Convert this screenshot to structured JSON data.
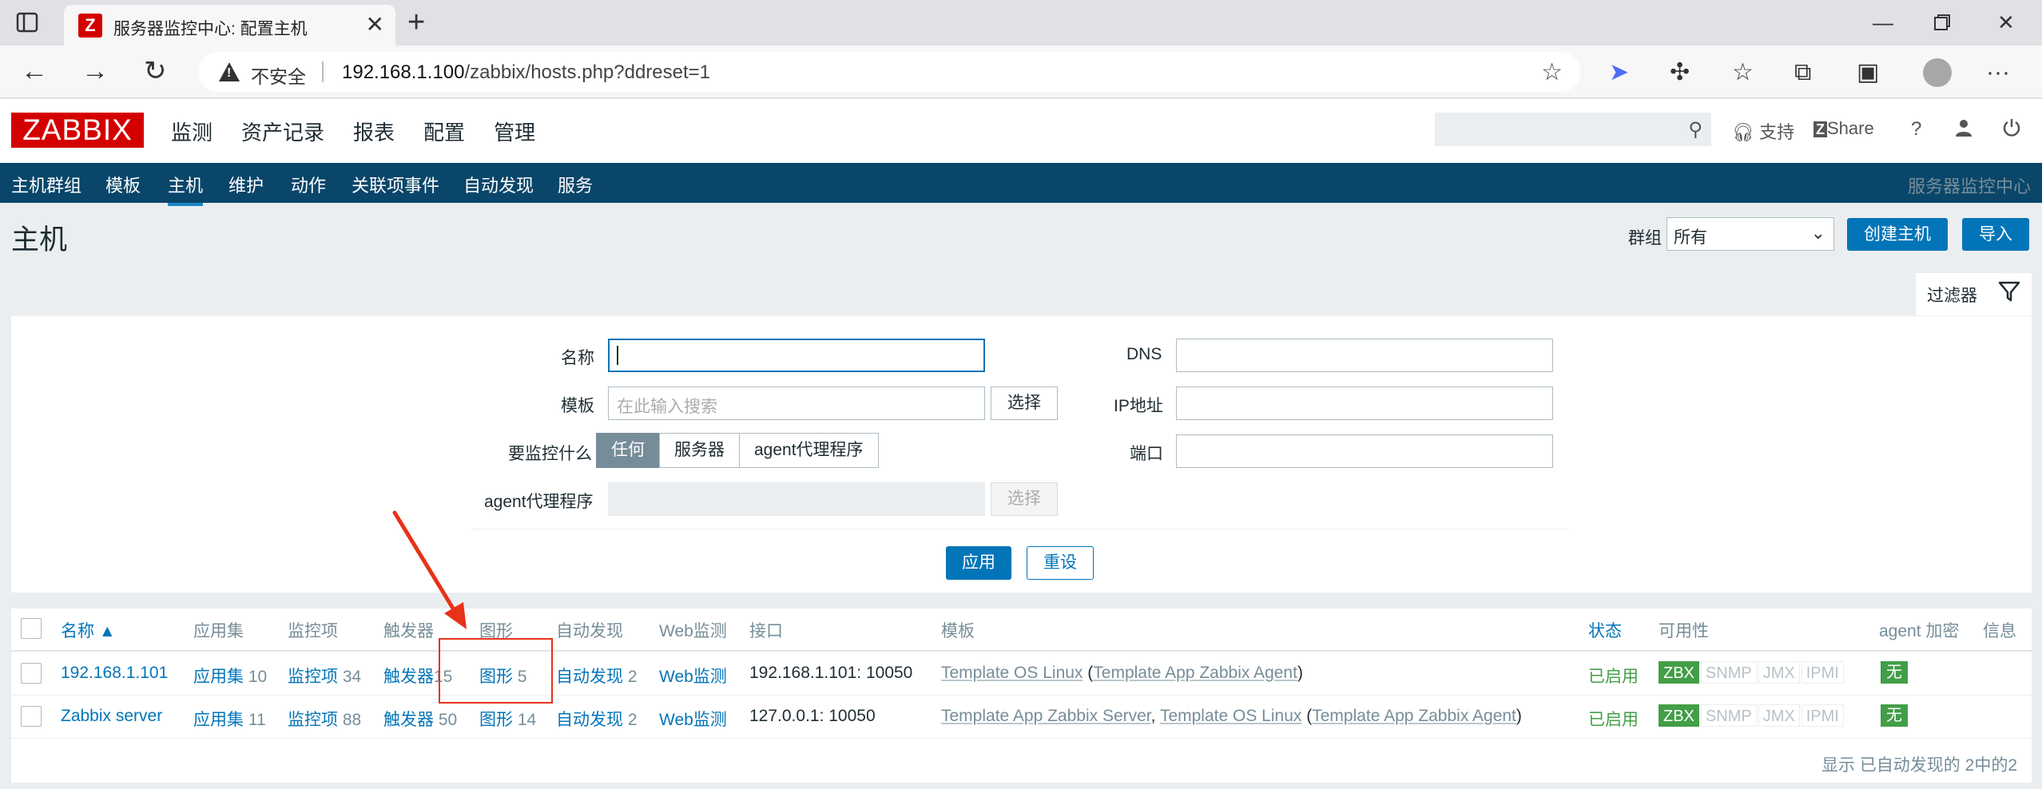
{
  "browser": {
    "tab_title": "服务器监控中心: 配置主机",
    "favicon_letter": "Z",
    "insecure_label": "不安全",
    "url_host": "192.168.1.100",
    "url_path": "/zabbix/hosts.php?ddreset=1"
  },
  "header": {
    "logo": "ZABBIX",
    "menu": [
      "监测",
      "资产记录",
      "报表",
      "配置",
      "管理"
    ],
    "active_menu": "配置",
    "support": "支持",
    "share": "Share",
    "help": "?"
  },
  "subnav": {
    "items": [
      "主机群组",
      "模板",
      "主机",
      "维护",
      "动作",
      "关联项事件",
      "自动发现",
      "服务"
    ],
    "active": "主机",
    "server_name": "服务器监控中心"
  },
  "page": {
    "title": "主机",
    "group_label": "群组",
    "group_value": "所有",
    "create_button": "创建主机",
    "import_button": "导入"
  },
  "filter": {
    "tab_label": "过滤器",
    "name_label": "名称",
    "name_value": "",
    "template_label": "模板",
    "template_placeholder": "在此输入搜索",
    "select_button": "选择",
    "monitor_label": "要监控什么",
    "monitor_options": [
      "任何",
      "服务器",
      "agent代理程序"
    ],
    "monitor_selected": "任何",
    "proxy_label": "agent代理程序",
    "proxy_select_button": "选择",
    "dns_label": "DNS",
    "ip_label": "IP地址",
    "port_label": "端口",
    "apply_button": "应用",
    "reset_button": "重设"
  },
  "table": {
    "headers": {
      "name": "名称 ▲",
      "apps": "应用集",
      "items": "监控项",
      "triggers": "触发器",
      "graphs": "图形",
      "discovery": "自动发现",
      "web": "Web监测",
      "interface": "接口",
      "templates": "模板",
      "status": "状态",
      "availability": "可用性",
      "encryption": "agent 加密",
      "info": "信息"
    },
    "rows": [
      {
        "name": "192.168.1.101",
        "apps_label": "应用集",
        "apps_count": "10",
        "items_label": "监控项",
        "items_count": "34",
        "triggers_label": "触发器",
        "triggers_count": "15",
        "graphs_label": "图形",
        "graphs_count": "5",
        "discovery_label": "自动发现",
        "discovery_count": "2",
        "web": "Web监测",
        "interface": "192.168.1.101: 10050",
        "template_1": "Template OS Linux",
        "template_sep": "",
        "template_2": "",
        "template_paren_open": " (",
        "template_linked": "Template App Zabbix Agent",
        "template_paren_close": ")",
        "status": "已启用",
        "availability": [
          "ZBX",
          "SNMP",
          "JMX",
          "IPMI"
        ],
        "encryption": "无"
      },
      {
        "name": "Zabbix server",
        "apps_label": "应用集",
        "apps_count": "11",
        "items_label": "监控项",
        "items_count": "88",
        "triggers_label": "触发器",
        "triggers_count": "50",
        "graphs_label": "图形",
        "graphs_count": "14",
        "discovery_label": "自动发现",
        "discovery_count": "2",
        "web": "Web监测",
        "interface": "127.0.0.1: 10050",
        "template_1": "Template App Zabbix Server",
        "template_sep": ", ",
        "template_2": "Template OS Linux",
        "template_paren_open": " (",
        "template_linked": "Template App Zabbix Agent",
        "template_paren_close": ")",
        "status": "已启用",
        "availability": [
          "ZBX",
          "SNMP",
          "JMX",
          "IPMI"
        ],
        "encryption": "无"
      }
    ],
    "footer": "显示 已自动发现的 2中的2"
  },
  "colors": {
    "accent": "#0275b8",
    "nav_bg": "#0a466a",
    "logo_red": "#d40000",
    "enabled_green": "#429e47",
    "annotation_red": "#e8321a"
  }
}
